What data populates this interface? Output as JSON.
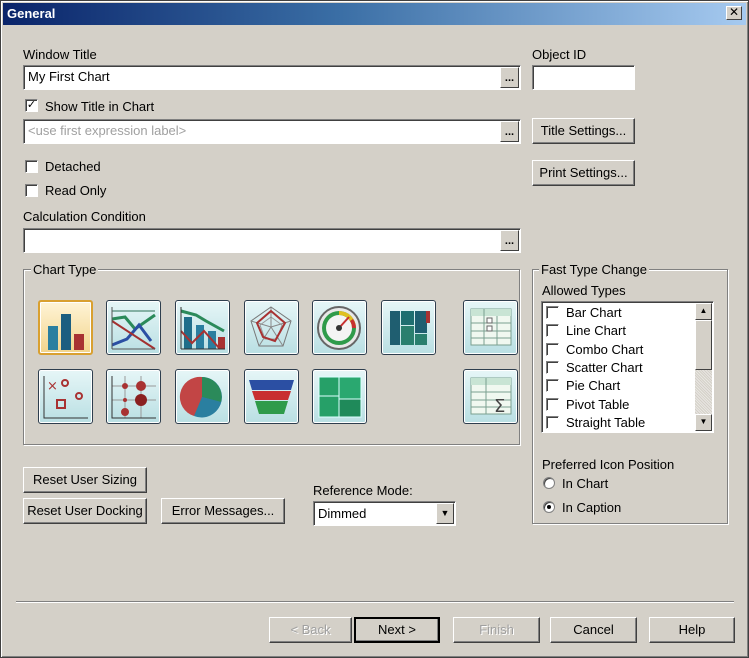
{
  "window": {
    "title": "General",
    "close_glyph": "✕"
  },
  "window_title": {
    "label": "Window Title",
    "value": "My First Chart",
    "browse": "..."
  },
  "show_title": {
    "label": "Show Title in Chart",
    "checked": true
  },
  "title_expression": {
    "placeholder": "<use first expression label>",
    "browse": "..."
  },
  "detached": {
    "label": "Detached",
    "checked": false
  },
  "read_only": {
    "label": "Read Only",
    "checked": false
  },
  "calc_condition": {
    "label": "Calculation Condition",
    "value": "",
    "browse": "..."
  },
  "object_id": {
    "label": "Object ID",
    "value": ""
  },
  "buttons": {
    "title_settings": "Title Settings...",
    "print_settings": "Print Settings...",
    "reset_user_sizing": "Reset User Sizing",
    "reset_user_docking": "Reset User Docking",
    "error_messages": "Error Messages..."
  },
  "chart_type": {
    "label": "Chart Type",
    "icons": [
      "bar-chart-icon",
      "line-chart-icon",
      "combo-chart-icon",
      "radar-chart-icon",
      "gauge-chart-icon",
      "mekko-chart-icon",
      "pivot-table-icon",
      "scatter-chart-icon",
      "grid-chart-icon",
      "pie-chart-icon",
      "funnel-chart-icon",
      "block-chart-icon",
      "straight-table-icon"
    ],
    "selected": "bar-chart-icon"
  },
  "reference_mode": {
    "label": "Reference Mode:",
    "value": "Dimmed"
  },
  "fast_type_change": {
    "label": "Fast Type Change",
    "allowed_label": "Allowed Types",
    "items": [
      "Bar Chart",
      "Line Chart",
      "Combo Chart",
      "Scatter Chart",
      "Pie Chart",
      "Pivot Table",
      "Straight Table"
    ],
    "preferred_label": "Preferred Icon Position",
    "options": [
      {
        "label": "In Chart",
        "selected": false
      },
      {
        "label": "In Caption",
        "selected": true
      }
    ]
  },
  "footer": {
    "back": "< Back",
    "next": "Next >",
    "finish": "Finish",
    "cancel": "Cancel",
    "help": "Help"
  }
}
